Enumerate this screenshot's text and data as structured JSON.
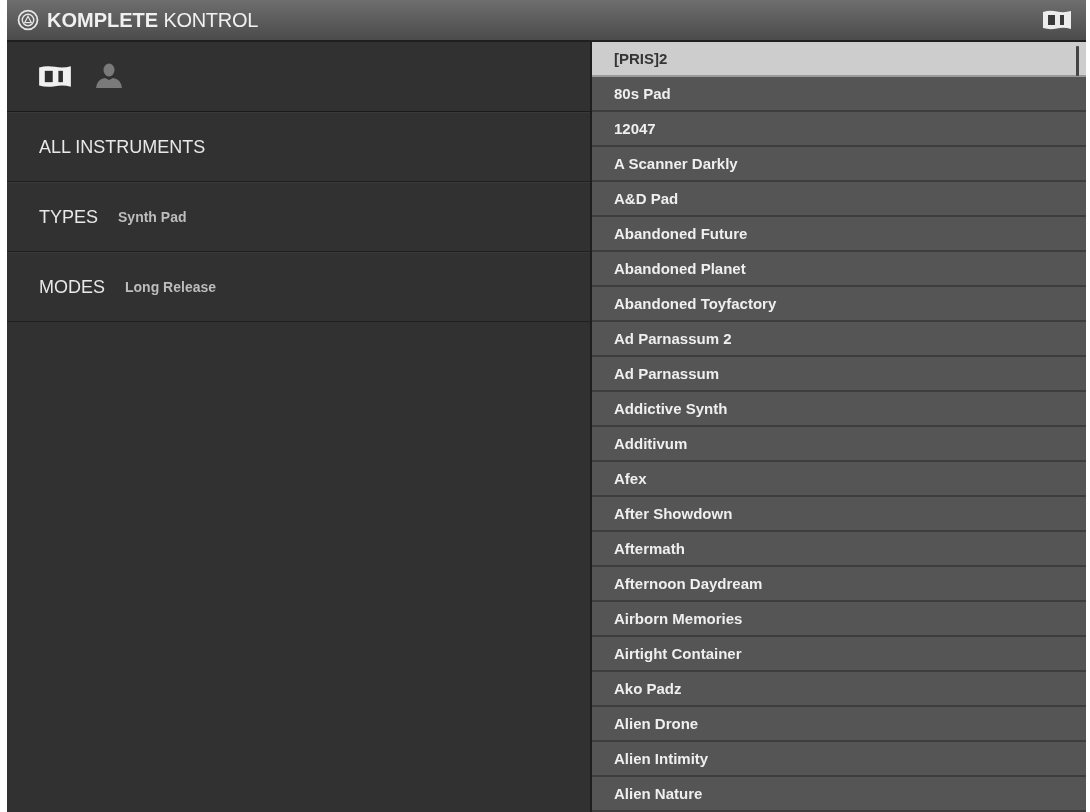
{
  "window": {
    "title": "**KOMPLETE** KONTROL"
  },
  "library_tabs": [
    {
      "kind": "factory",
      "selected": true
    },
    {
      "kind": "user",
      "selected": false
    }
  ],
  "filters": [
    {
      "label": "ALL INSTRUMENTS"
    },
    {
      "label": "TYPES",
      "value": "Synth Pad"
    },
    {
      "label": "MODES",
      "value": "Long Release"
    }
  ],
  "presets": [
    {
      "name": "[PRIS]2",
      "selected": true
    },
    {
      "name": "80s Pad",
      "selected": false
    },
    {
      "name": "12047",
      "selected": false
    },
    {
      "name": "A Scanner Darkly",
      "selected": false
    },
    {
      "name": "A&D Pad",
      "selected": false
    },
    {
      "name": "Abandoned Future",
      "selected": false
    },
    {
      "name": "Abandoned Planet",
      "selected": false
    },
    {
      "name": "Abandoned Toyfactory",
      "selected": false
    },
    {
      "name": "Ad Parnassum 2",
      "selected": false
    },
    {
      "name": "Ad Parnassum",
      "selected": false
    },
    {
      "name": "Addictive Synth",
      "selected": false
    },
    {
      "name": "Additivum",
      "selected": false
    },
    {
      "name": "Afex",
      "selected": false
    },
    {
      "name": "After Showdown",
      "selected": false
    },
    {
      "name": "Aftermath",
      "selected": false
    },
    {
      "name": "Afternoon Daydream",
      "selected": false
    },
    {
      "name": "Airborn Memories",
      "selected": false
    },
    {
      "name": "Airtight Container",
      "selected": false
    },
    {
      "name": "Ako Padz",
      "selected": false
    },
    {
      "name": "Alien Drone",
      "selected": false
    },
    {
      "name": "Alien Intimity",
      "selected": false
    },
    {
      "name": "Alien Nature",
      "selected": false
    }
  ]
}
